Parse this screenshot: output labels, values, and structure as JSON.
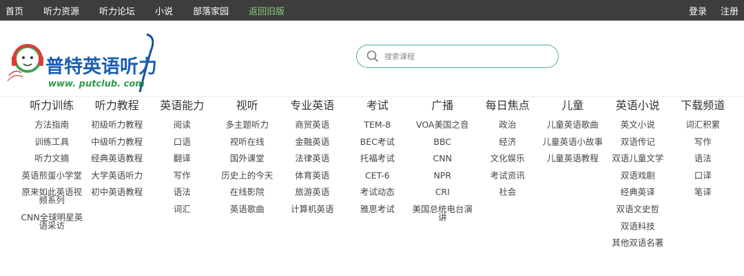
{
  "topnav": {
    "left": [
      "首页",
      "听力资源",
      "听力论坛",
      "小说",
      "部落家园",
      "返回旧版"
    ],
    "right": [
      "登录",
      "注册"
    ]
  },
  "logo": {
    "name": "普特英语听力",
    "url": "www. putclub. com"
  },
  "search": {
    "placeholder": "搜索课程"
  },
  "categories": [
    {
      "title": "听力训练",
      "items": [
        "方法指南",
        "训练工具",
        "听力文摘",
        "英语煎蛋小学堂",
        "原来如此英语视频系列",
        "CNN全球明星英语采访"
      ]
    },
    {
      "title": "听力教程",
      "items": [
        "初级听力教程",
        "中级听力教程",
        "经典英语教程",
        "大学英语听力",
        "初中英语教程"
      ]
    },
    {
      "title": "英语能力",
      "items": [
        "阅读",
        "口语",
        "翻译",
        "写作",
        "语法",
        "词汇"
      ]
    },
    {
      "title": "视听",
      "items": [
        "多主题听力",
        "视听在线",
        "国外课堂",
        "历史上的今天",
        "在线影院",
        "英语歌曲"
      ]
    },
    {
      "title": "专业英语",
      "items": [
        "商贸英语",
        "金融英语",
        "法律英语",
        "体育英语",
        "旅游英语",
        "计算机英语"
      ]
    },
    {
      "title": "考试",
      "items": [
        "TEM-8",
        "BEC考试",
        "托福考试",
        "CET-6",
        "考试动态",
        "雅思考试"
      ]
    },
    {
      "title": "广播",
      "items": [
        "VOA美国之音",
        "BBC",
        "CNN",
        "NPR",
        "CRI",
        "美国总统电台演讲"
      ]
    },
    {
      "title": "每日焦点",
      "items": [
        "政治",
        "经济",
        "文化娱乐",
        "考试资讯",
        "社会"
      ]
    },
    {
      "title": "儿童",
      "items": [
        "儿童英语歌曲",
        "儿童英语小故事",
        "儿童英语教程"
      ]
    },
    {
      "title": "英语小说",
      "items": [
        "英文小说",
        "双语传记",
        "双语儿童文学",
        "双语戏剧",
        "经典英译",
        "双语文史哲",
        "双语科技",
        "其他双语名著"
      ]
    },
    {
      "title": "下载频道",
      "items": [
        "词汇积累",
        "写作",
        "语法",
        "口译",
        "笔译"
      ]
    }
  ]
}
